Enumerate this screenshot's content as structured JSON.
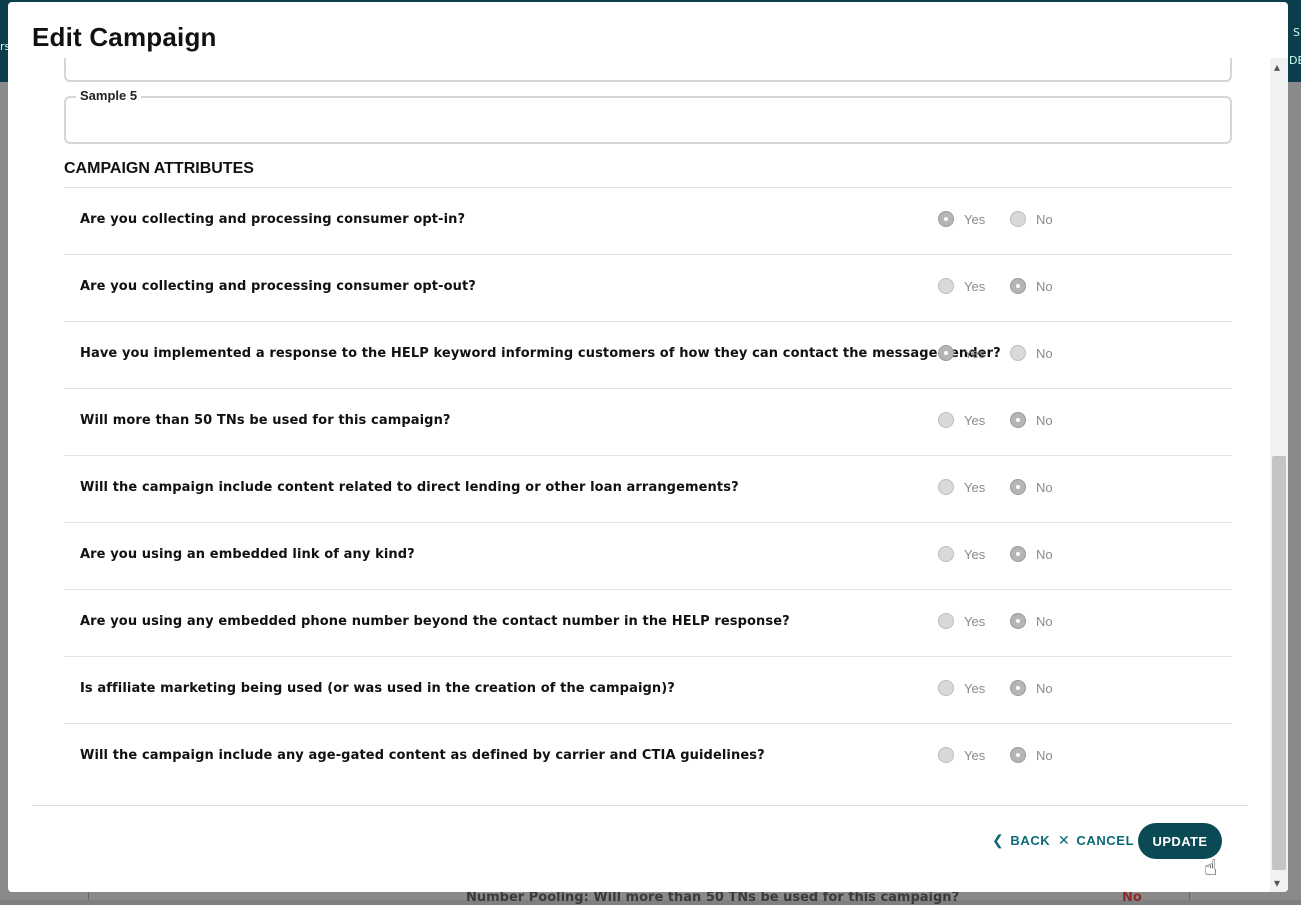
{
  "background": {
    "left_fragment": "rs",
    "right_fragment_1": "S",
    "right_fragment_2": "DE",
    "row_text": "Number Pooling:  Will more than 50 TNs be used for this campaign?",
    "row_value": "No"
  },
  "modal": {
    "title": "Edit Campaign",
    "sample_field_label": "Sample 5",
    "section_heading": "CAMPAIGN ATTRIBUTES",
    "yes_label": "Yes",
    "no_label": "No",
    "attributes": [
      {
        "question": "Are you collecting and processing consumer opt-in?",
        "selected": "Yes"
      },
      {
        "question": "Are you collecting and processing consumer opt-out?",
        "selected": "No"
      },
      {
        "question": "Have you implemented a response to the HELP keyword informing customers of how they can contact the message sender?",
        "selected": "Yes"
      },
      {
        "question": "Will more than 50 TNs be used for this campaign?",
        "selected": "No"
      },
      {
        "question": "Will the campaign include content related to direct lending or other loan arrangements?",
        "selected": "No"
      },
      {
        "question": "Are you using an embedded link of any kind?",
        "selected": "No"
      },
      {
        "question": "Are you using any embedded phone number beyond the contact number in the HELP response?",
        "selected": "No"
      },
      {
        "question": "Is affiliate marketing being used (or was used in the creation of the campaign)?",
        "selected": "No"
      },
      {
        "question": "Will the campaign include any age-gated content as defined by carrier and CTIA guidelines?",
        "selected": "No"
      }
    ],
    "footer": {
      "back_label": "BACK",
      "cancel_label": "CANCEL",
      "update_label": "UPDATE"
    }
  },
  "icons": {
    "back": "chevron-left-icon",
    "cancel": "close-icon",
    "cursor": "hand-pointer-icon"
  },
  "colors": {
    "accent": "#0b6a78",
    "primary_button": "#0b4a55",
    "header_bg": "#0b3d4a"
  }
}
